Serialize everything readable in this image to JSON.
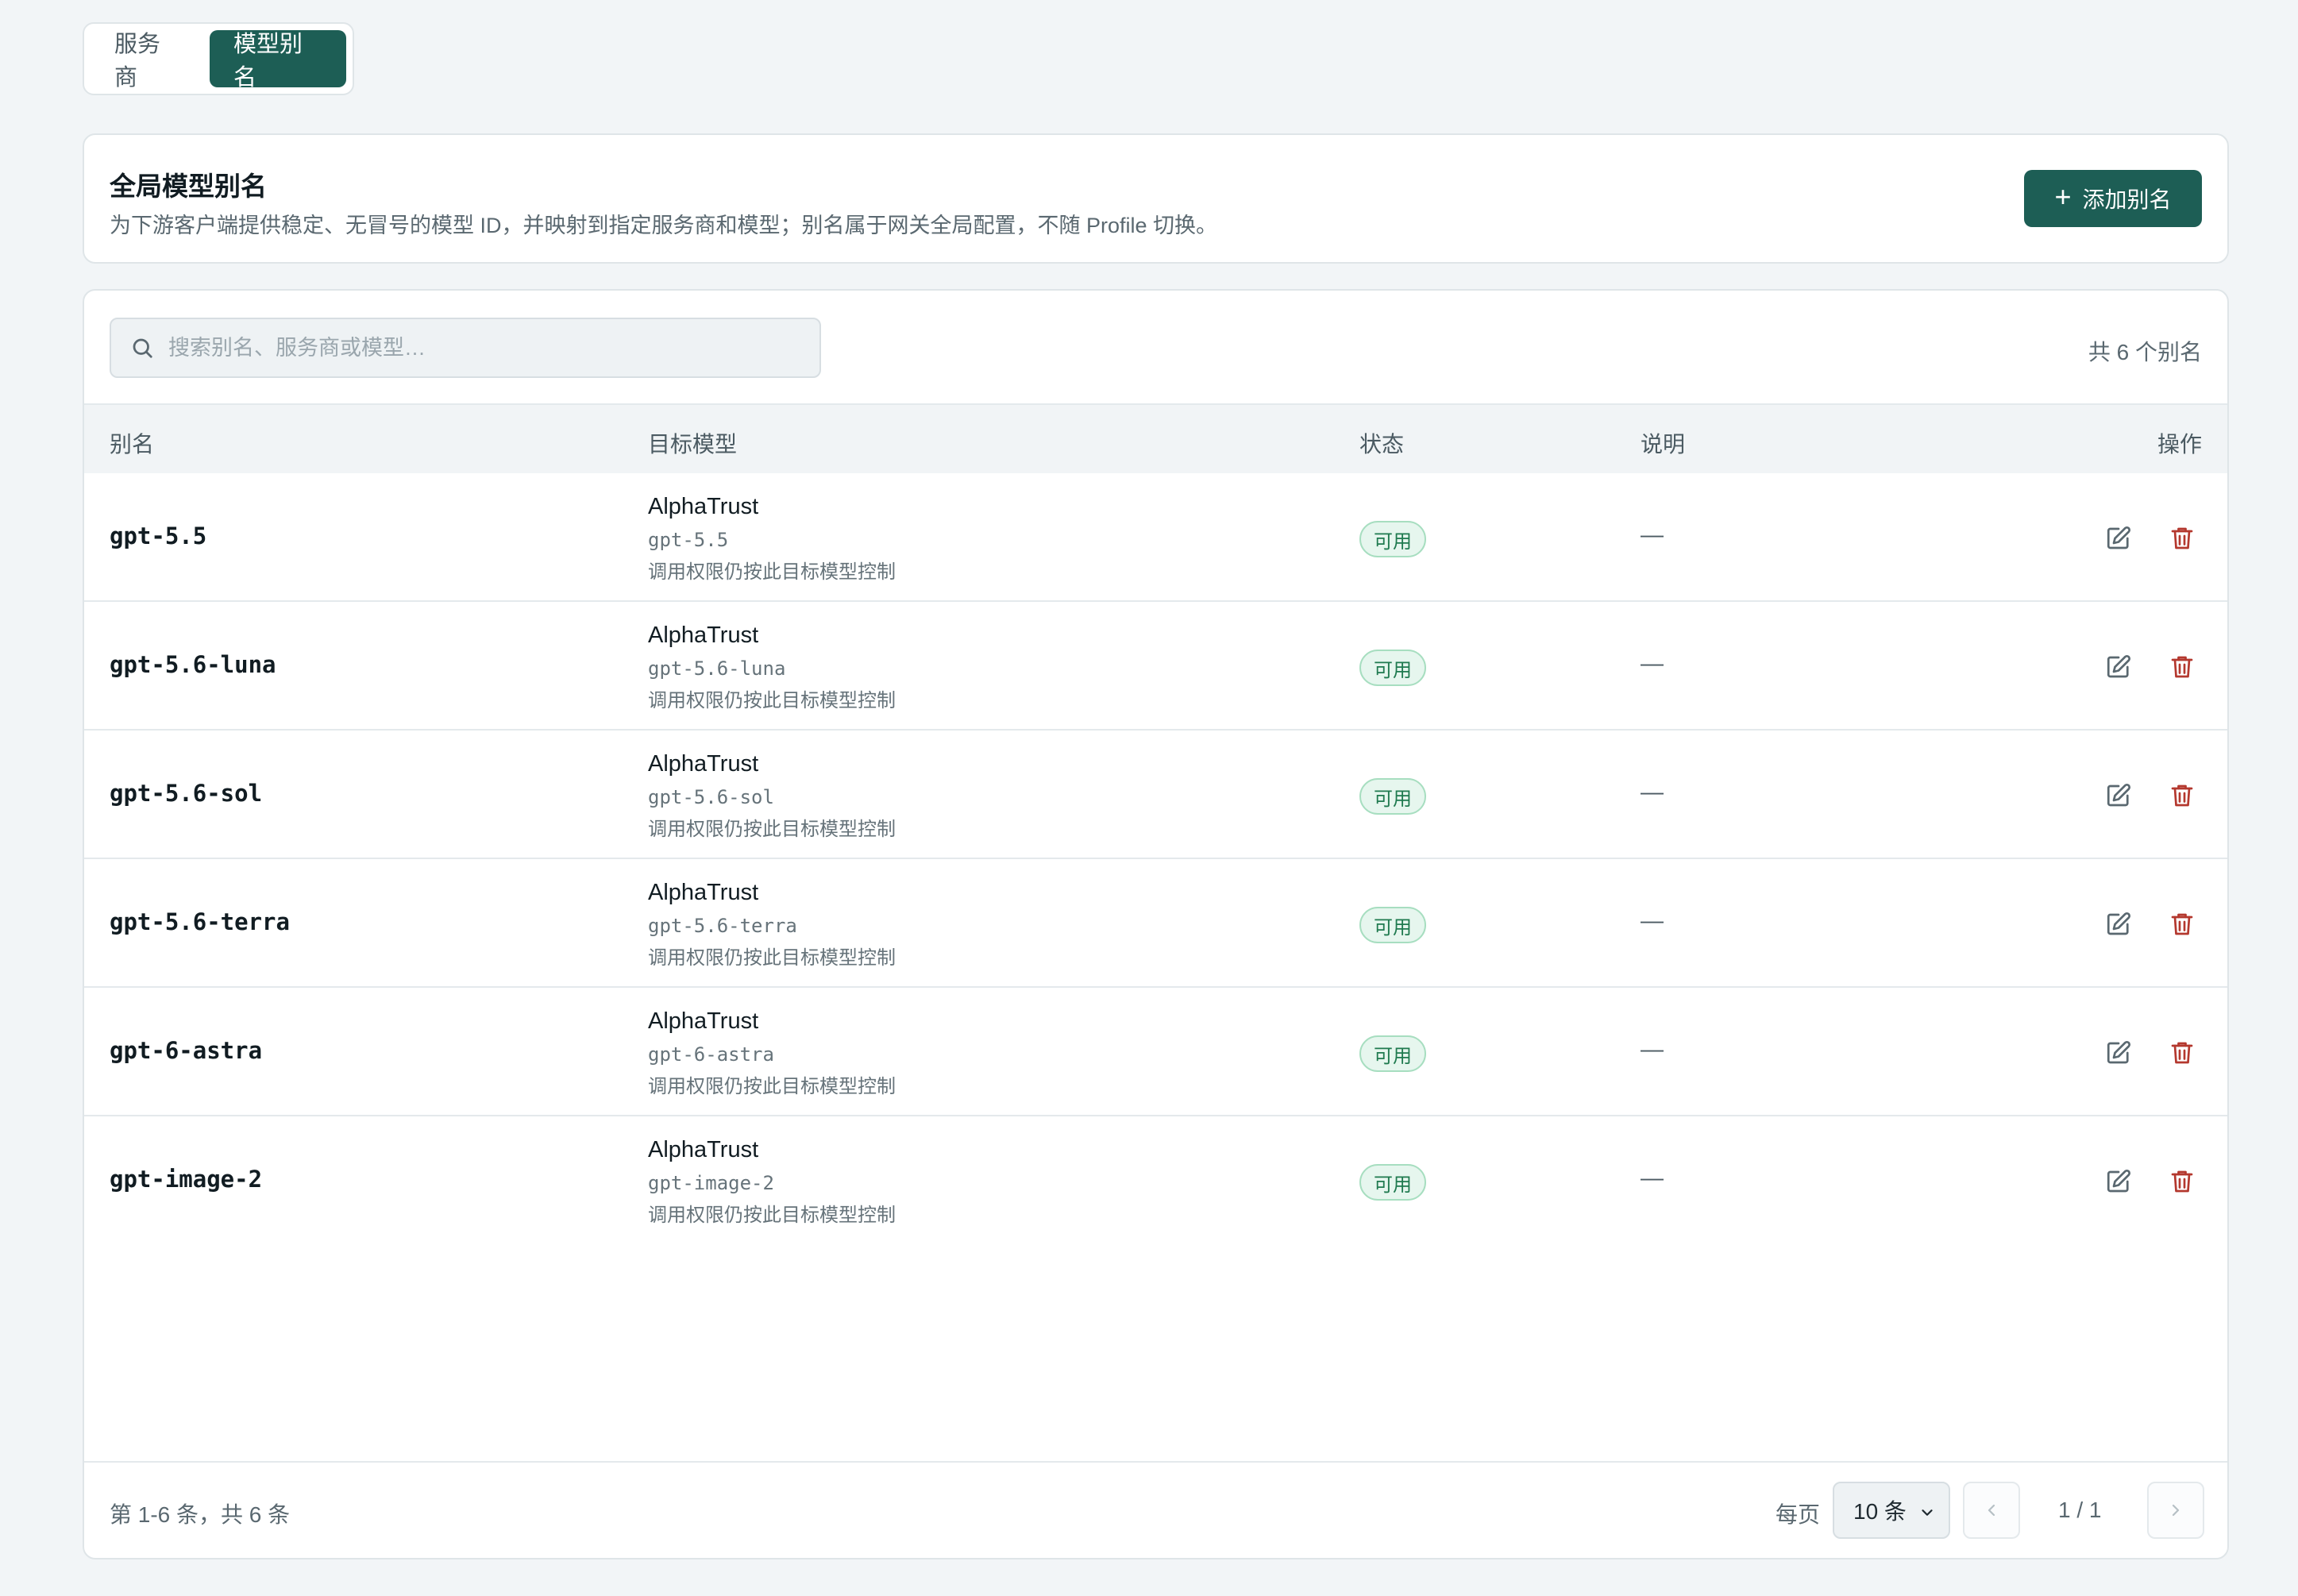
{
  "tabs": [
    {
      "label": "服务商",
      "active": false
    },
    {
      "label": "模型别名",
      "active": true
    }
  ],
  "header": {
    "title": "全局模型别名",
    "description": "为下游客户端提供稳定、无冒号的模型 ID，并映射到指定服务商和模型；别名属于网关全局配置，不随 Profile 切换。",
    "add_button_label": "添加别名"
  },
  "search": {
    "placeholder": "搜索别名、服务商或模型…"
  },
  "total_label": "共 6 个别名",
  "columns": {
    "alias": "别名",
    "target": "目标模型",
    "status": "状态",
    "description": "说明",
    "actions": "操作"
  },
  "rows": [
    {
      "alias": "gpt-5.5",
      "provider": "AlphaTrust",
      "model": "gpt-5.5",
      "note": "调用权限仍按此目标模型控制",
      "status": "可用",
      "description": "—"
    },
    {
      "alias": "gpt-5.6-luna",
      "provider": "AlphaTrust",
      "model": "gpt-5.6-luna",
      "note": "调用权限仍按此目标模型控制",
      "status": "可用",
      "description": "—"
    },
    {
      "alias": "gpt-5.6-sol",
      "provider": "AlphaTrust",
      "model": "gpt-5.6-sol",
      "note": "调用权限仍按此目标模型控制",
      "status": "可用",
      "description": "—"
    },
    {
      "alias": "gpt-5.6-terra",
      "provider": "AlphaTrust",
      "model": "gpt-5.6-terra",
      "note": "调用权限仍按此目标模型控制",
      "status": "可用",
      "description": "—"
    },
    {
      "alias": "gpt-6-astra",
      "provider": "AlphaTrust",
      "model": "gpt-6-astra",
      "note": "调用权限仍按此目标模型控制",
      "status": "可用",
      "description": "—"
    },
    {
      "alias": "gpt-image-2",
      "provider": "AlphaTrust",
      "model": "gpt-image-2",
      "note": "调用权限仍按此目标模型控制",
      "status": "可用",
      "description": "—"
    }
  ],
  "footer": {
    "range_label": "第 1-6 条，共 6 条",
    "per_page_label": "每页",
    "per_page_value": "10 条",
    "page_indicator": "1 / 1"
  },
  "colors": {
    "accent": "#1d5e55",
    "status_ok_text": "#1f7a4f",
    "status_ok_bg": "#e6f6ee",
    "danger": "#b4382e"
  },
  "icons": {
    "add": "plus-icon",
    "search": "search-icon",
    "edit": "edit-icon",
    "delete": "trash-icon",
    "select": "chevron-down-icon",
    "prev": "chevron-left-icon",
    "next": "chevron-right-icon"
  }
}
